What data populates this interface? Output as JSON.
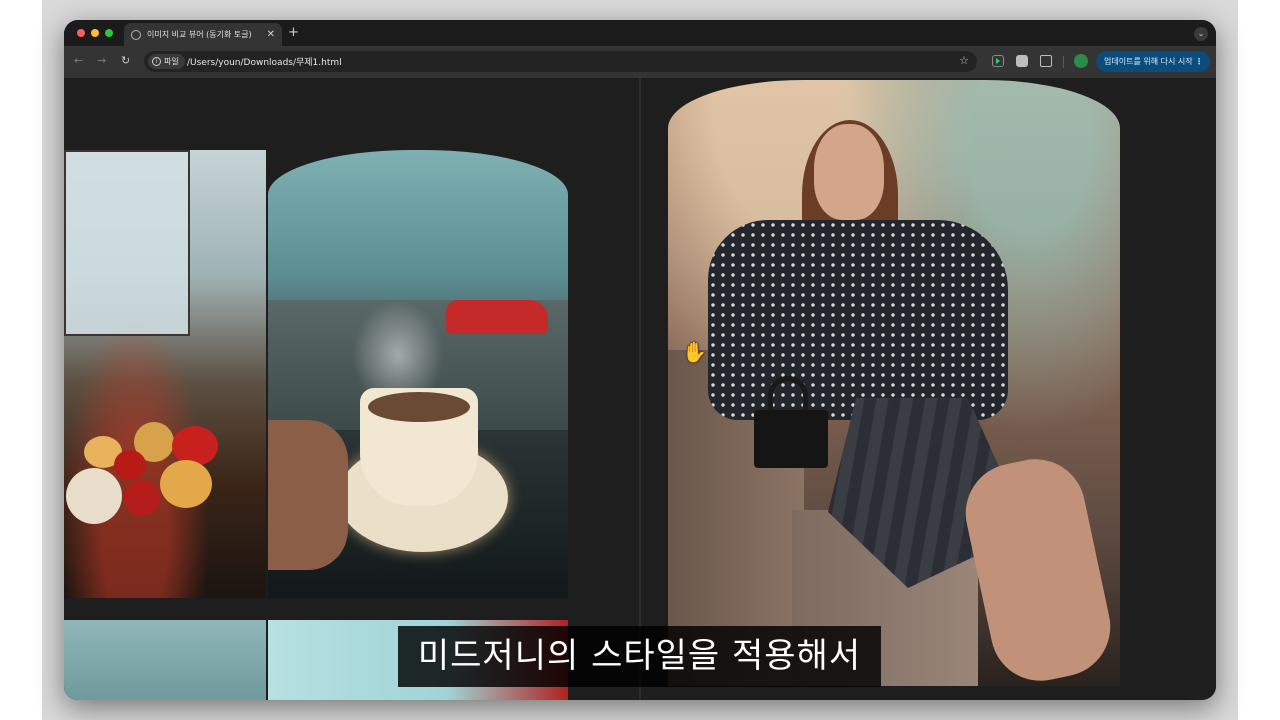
{
  "browser": {
    "tab_title": "이미지 비교 뷰어 (동기화 토글)",
    "site_label": "파일",
    "url": "/Users/youn/Downloads/무제1.html",
    "update_button_label": "업데이트를 위해 다시 시작"
  },
  "subtitle": {
    "text": "미드저니의 스타일을 적용해서"
  },
  "colors": {
    "window_bg": "#202020",
    "toolbar_bg": "#343434",
    "update_button_bg": "#0b4c7a",
    "caption_bg": "#000000"
  }
}
